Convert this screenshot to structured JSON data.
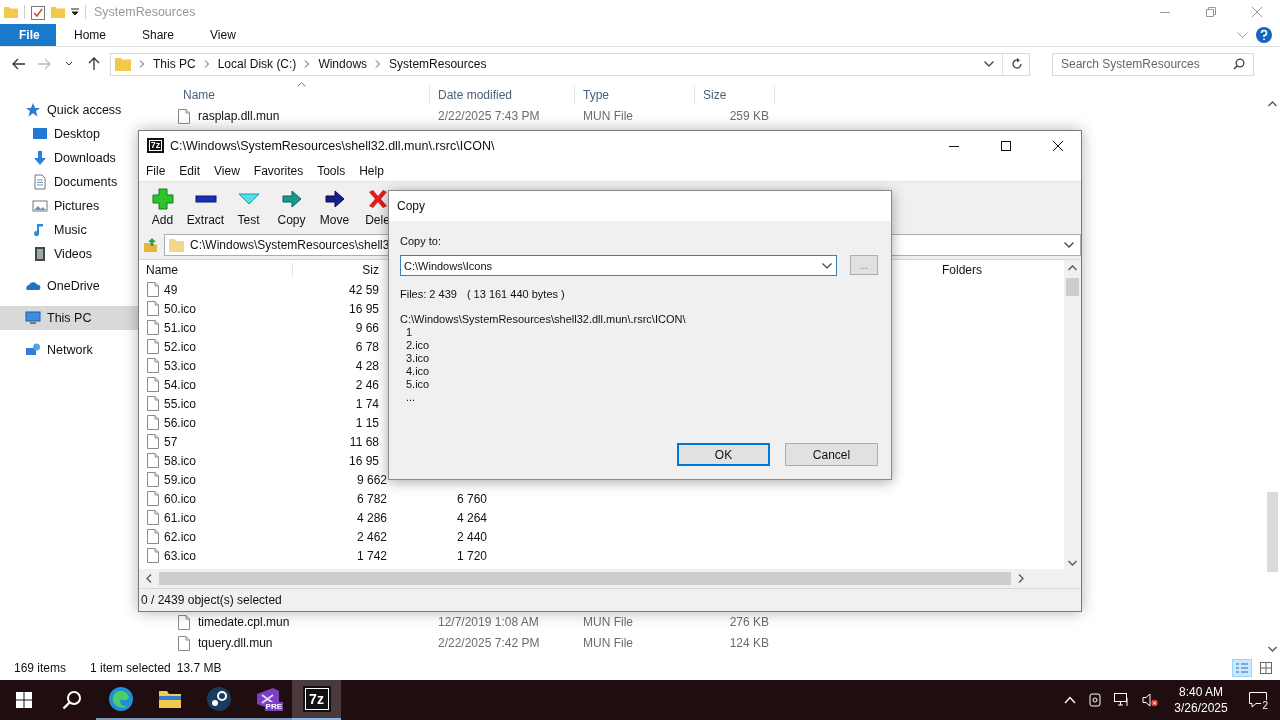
{
  "explorer": {
    "title": "SystemResources",
    "ribbon_tabs": [
      {
        "label": "File",
        "kind": "file"
      },
      {
        "label": "Home",
        "kind": "tab"
      },
      {
        "label": "Share",
        "kind": "tab"
      },
      {
        "label": "View",
        "kind": "tab"
      }
    ],
    "nav_buttons": [
      {
        "kind": "back",
        "disabled": false
      },
      {
        "kind": "forward",
        "disabled": true
      },
      {
        "kind": "recent",
        "disabled": false
      },
      {
        "kind": "up",
        "disabled": false
      }
    ],
    "breadcrumb": [
      "This PC",
      "Local Disk (C:)",
      "Windows",
      "SystemResources"
    ],
    "search": {
      "placeholder": "Search SystemResources"
    },
    "nav": [
      {
        "label": "Quick access",
        "kind": "star",
        "selected": false,
        "children": [
          {
            "label": "Desktop",
            "kind": "desktop",
            "selected": false
          },
          {
            "label": "Downloads",
            "kind": "downloads",
            "selected": false
          },
          {
            "label": "Documents",
            "kind": "documents",
            "selected": false
          },
          {
            "label": "Pictures",
            "kind": "pictures",
            "selected": false
          },
          {
            "label": "Music",
            "kind": "music",
            "selected": false
          },
          {
            "label": "Videos",
            "kind": "videos",
            "selected": false
          }
        ]
      },
      {
        "label": "OneDrive",
        "kind": "cloud",
        "selected": false
      },
      {
        "label": "This PC",
        "kind": "pc",
        "selected": true
      },
      {
        "label": "Network",
        "kind": "network",
        "selected": false
      }
    ],
    "columns": [
      "Name",
      "Date modified",
      "Type",
      "Size"
    ],
    "files_top": [
      {
        "name": "rasplap.dll.mun",
        "date": "2/22/2025 7:43 PM",
        "type": "MUN File",
        "size": "259 KB"
      }
    ],
    "files_bottom": [
      {
        "name": "timedate.cpl.mun",
        "date": "12/7/2019 1:08 AM",
        "type": "MUN File",
        "size": "276 KB"
      },
      {
        "name": "tquery.dll.mun",
        "date": "2/22/2025 7:42 PM",
        "type": "MUN File",
        "size": "124 KB"
      }
    ],
    "status": {
      "count": "169 items",
      "selection": "1 item selected",
      "size": "13.7 MB"
    }
  },
  "sevenzip": {
    "icon_text": "7z",
    "title": "C:\\Windows\\SystemResources\\shell32.dll.mun\\.rsrc\\ICON\\",
    "menu": [
      "File",
      "Edit",
      "View",
      "Favorites",
      "Tools",
      "Help"
    ],
    "toolbar": [
      {
        "label": "Add",
        "kind": "add"
      },
      {
        "label": "Extract",
        "kind": "extract"
      },
      {
        "label": "Test",
        "kind": "test"
      },
      {
        "label": "Copy",
        "kind": "copy"
      },
      {
        "label": "Move",
        "kind": "move"
      },
      {
        "label": "Dele",
        "kind": "delete"
      }
    ],
    "path": "C:\\Windows\\SystemResources\\shell3",
    "columns": [
      "Name",
      "Siz",
      "Folders"
    ],
    "rows": [
      {
        "name": "49",
        "size": "42 59"
      },
      {
        "name": "50.ico",
        "size": "16 95"
      },
      {
        "name": "51.ico",
        "size": "9 66"
      },
      {
        "name": "52.ico",
        "size": "6 78"
      },
      {
        "name": "53.ico",
        "size": "4 28"
      },
      {
        "name": "54.ico",
        "size": "2 46"
      },
      {
        "name": "55.ico",
        "size": "1 74"
      },
      {
        "name": "56.ico",
        "size": "1 15"
      },
      {
        "name": "57",
        "size": "11 68"
      },
      {
        "name": "58.ico",
        "size": "16 95"
      },
      {
        "name": "59.ico",
        "size": "9 662"
      },
      {
        "name": "60.ico",
        "size": "6 782",
        "packed": "6 760"
      },
      {
        "name": "61.ico",
        "size": "4 286",
        "packed": "4 264"
      },
      {
        "name": "62.ico",
        "size": "2 462",
        "packed": "2 440"
      },
      {
        "name": "63.ico",
        "size": "1 742",
        "packed": "1 720"
      }
    ],
    "status": "0 / 2439 object(s) selected"
  },
  "copy_dialog": {
    "title": "Copy",
    "label": "Copy to:",
    "value": "C:\\Windows\\Icons",
    "browse": "...",
    "files": "Files: 2 439",
    "bytes": "( 13 161 440 bytes )",
    "source": "C:\\Windows\\SystemResources\\shell32.dll.mun\\.rsrc\\ICON\\",
    "items": [
      "1",
      "2.ico",
      "3.ico",
      "4.ico",
      "5.ico",
      "..."
    ],
    "buttons": [
      {
        "label": "OK",
        "default": true
      },
      {
        "label": "Cancel",
        "default": false
      }
    ]
  },
  "taskbar": {
    "apps": [
      {
        "kind": "browser",
        "active": false
      },
      {
        "kind": "folder",
        "active": false
      },
      {
        "kind": "steam",
        "active": false
      },
      {
        "kind": "vs",
        "badge": "PRE",
        "active": false
      },
      {
        "kind": "sevenzip",
        "label": "7z",
        "active": true
      }
    ],
    "time": "8:40 AM",
    "date": "3/26/2025",
    "notifications": "2"
  }
}
